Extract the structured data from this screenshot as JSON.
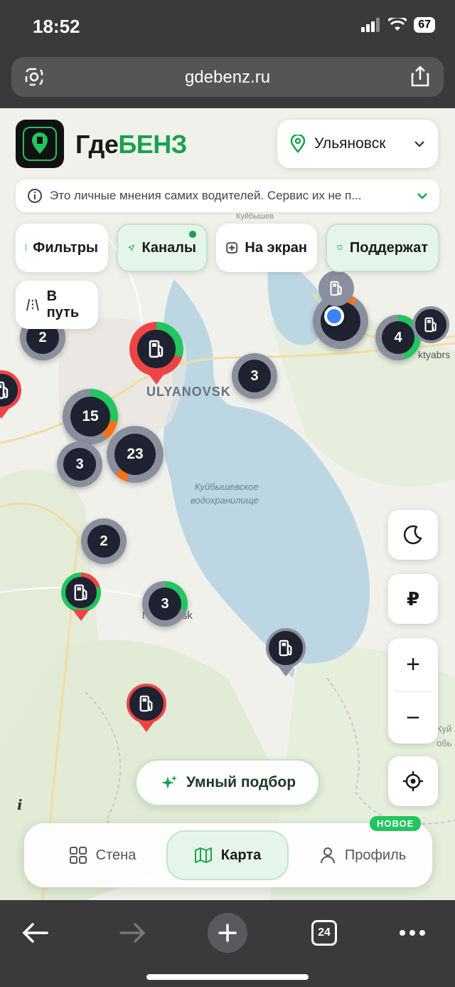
{
  "status": {
    "time": "18:52",
    "battery": "67"
  },
  "browser": {
    "url": "gdebenz.ru",
    "tabs_count": "24"
  },
  "brand": {
    "part1": "Где",
    "part2": "БЕНЗ"
  },
  "city": {
    "label": "Ульяновск"
  },
  "notice": {
    "text": "Это личные мнения самих водителей. Сервис их не п..."
  },
  "chips": {
    "filters": "Фильтры",
    "channels": "Каналы",
    "on_screen": "На экран",
    "support": "Поддержат"
  },
  "route": {
    "label": "В путь"
  },
  "map": {
    "labels": {
      "city1": "ULYANOVSK",
      "reservoir1": "Куйбышевское",
      "reservoir2": "водохранилище",
      "town": "N   anovsk",
      "oktyabrsk": "ktyabrs",
      "kuybyshev_top": "Куйбышев",
      "kuy_right": "Куй",
      "kuy_right2": "обь"
    },
    "clusters": [
      "2",
      "3",
      "4",
      "15",
      "3",
      "23",
      "2",
      "3"
    ]
  },
  "controls": {
    "currency": "₽",
    "zoom_in": "+",
    "zoom_out": "−"
  },
  "smart_pick": {
    "label": "Умный подбор"
  },
  "nav": {
    "wall": "Стена",
    "map": "Карта",
    "profile": "Профиль",
    "new_badge": "НОВОЕ"
  },
  "colors": {
    "accent": "#16a34a",
    "danger": "#ef4444",
    "dark_marker": "#1f2230"
  }
}
